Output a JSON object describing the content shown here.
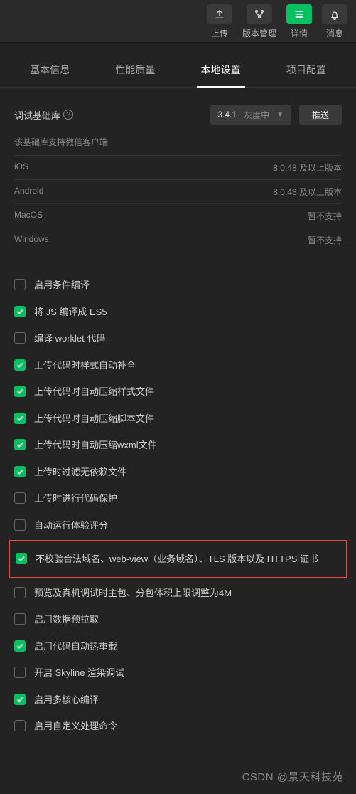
{
  "toolbar": {
    "items": [
      {
        "id": "upload",
        "label": "上传",
        "icon": "upload-icon",
        "green": false
      },
      {
        "id": "vcs",
        "label": "版本管理",
        "icon": "branch-icon",
        "green": false
      },
      {
        "id": "details",
        "label": "详情",
        "icon": "menu-icon",
        "green": true
      },
      {
        "id": "messages",
        "label": "消息",
        "icon": "bell-icon",
        "green": false
      }
    ]
  },
  "tabs": [
    {
      "id": "basic",
      "label": "基本信息",
      "active": false
    },
    {
      "id": "perf",
      "label": "性能质量",
      "active": false
    },
    {
      "id": "local",
      "label": "本地设置",
      "active": true
    },
    {
      "id": "project",
      "label": "项目配置",
      "active": false
    }
  ],
  "debug": {
    "label": "调试基础库",
    "version": "3.4.1",
    "tag": "灰度中",
    "push": "推送",
    "support_text": "该基础库支持微信客户端",
    "rows": [
      {
        "os": "iOS",
        "ver": "8.0.48 及以上版本"
      },
      {
        "os": "Android",
        "ver": "8.0.48 及以上版本"
      },
      {
        "os": "MacOS",
        "ver": "暂不支持"
      },
      {
        "os": "Windows",
        "ver": "暂不支持"
      }
    ]
  },
  "options": [
    {
      "id": "cond-compile",
      "label": "启用条件编译",
      "checked": false
    },
    {
      "id": "es5",
      "label": "将 JS 编译成 ES5",
      "checked": true
    },
    {
      "id": "worklet",
      "label": "编译 worklet 代码",
      "checked": false
    },
    {
      "id": "style-complete",
      "label": "上传代码时样式自动补全",
      "checked": true
    },
    {
      "id": "compress-style",
      "label": "上传代码时自动压缩样式文件",
      "checked": true
    },
    {
      "id": "compress-script",
      "label": "上传代码时自动压缩脚本文件",
      "checked": true
    },
    {
      "id": "compress-wxml",
      "label": "上传代码时自动压缩wxml文件",
      "checked": true
    },
    {
      "id": "filter-nodep",
      "label": "上传时过滤无依赖文件",
      "checked": true
    },
    {
      "id": "code-protect",
      "label": "上传时进行代码保护",
      "checked": false
    },
    {
      "id": "auto-audit",
      "label": "自动运行体验评分",
      "checked": false
    },
    {
      "id": "skip-domain",
      "label": "不校验合法域名、web-view（业务域名）、TLS 版本以及 HTTPS 证书",
      "checked": true,
      "highlight": true
    },
    {
      "id": "preview-4m",
      "label": "预览及真机调试时主包、分包体积上限调整为4M",
      "checked": false
    },
    {
      "id": "prefetch",
      "label": "启用数据预拉取",
      "checked": false
    },
    {
      "id": "hot-reload",
      "label": "启用代码自动热重载",
      "checked": true
    },
    {
      "id": "skyline",
      "label": "开启 Skyline 渲染调试",
      "checked": false
    },
    {
      "id": "multicore",
      "label": "启用多核心编译",
      "checked": true
    },
    {
      "id": "custom-cmd",
      "label": "启用自定义处理命令",
      "checked": false
    }
  ],
  "watermark": "CSDN @景天科技苑"
}
